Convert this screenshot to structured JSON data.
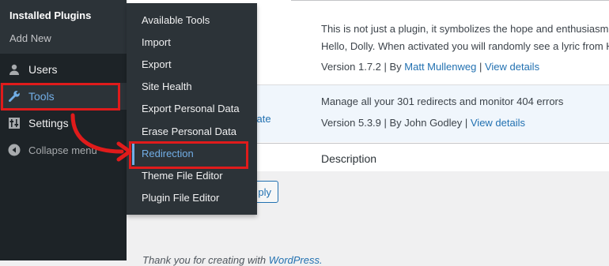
{
  "sidebar": {
    "plugins_submenu": {
      "current": "Installed Plugins",
      "add_new": "Add New"
    },
    "items": [
      {
        "label": "Users",
        "icon": "users-icon"
      },
      {
        "label": "Tools",
        "icon": "wrench-icon"
      },
      {
        "label": "Settings",
        "icon": "sliders-icon"
      },
      {
        "label": "Collapse menu",
        "icon": "collapse-icon"
      }
    ]
  },
  "tools_flyout": {
    "items": [
      "Available Tools",
      "Import",
      "Export",
      "Site Health",
      "Export Personal Data",
      "Erase Personal Data",
      "Redirection",
      "Theme File Editor",
      "Plugin File Editor"
    ],
    "active": "Redirection"
  },
  "plugins": {
    "hello_dolly": {
      "desc_line1": "This is not just a plugin, it symbolizes the hope and enthusiasm",
      "desc_line2": "Hello, Dolly. When activated you will randomly see a lyric from H",
      "version": "Version 1.7.2 | By ",
      "author": "Matt Mullenweg",
      "sep": " | ",
      "view_details": "View details"
    },
    "redirection": {
      "action_partial": "vate",
      "desc": "Manage all your 301 redirects and monitor 404 errors",
      "version": "Version 5.3.9 | By John Godley | ",
      "view_details": "View details"
    },
    "column_header": "Description",
    "apply_partial": "ply"
  },
  "footer": {
    "text": "Thank you for creating with ",
    "link": "WordPress."
  },
  "colors": {
    "sidebar_bg": "#1d2327",
    "submenu_bg": "#2c3338",
    "link": "#2271b1",
    "highlight": "#72aee6",
    "annotation": "#e01b1b"
  }
}
